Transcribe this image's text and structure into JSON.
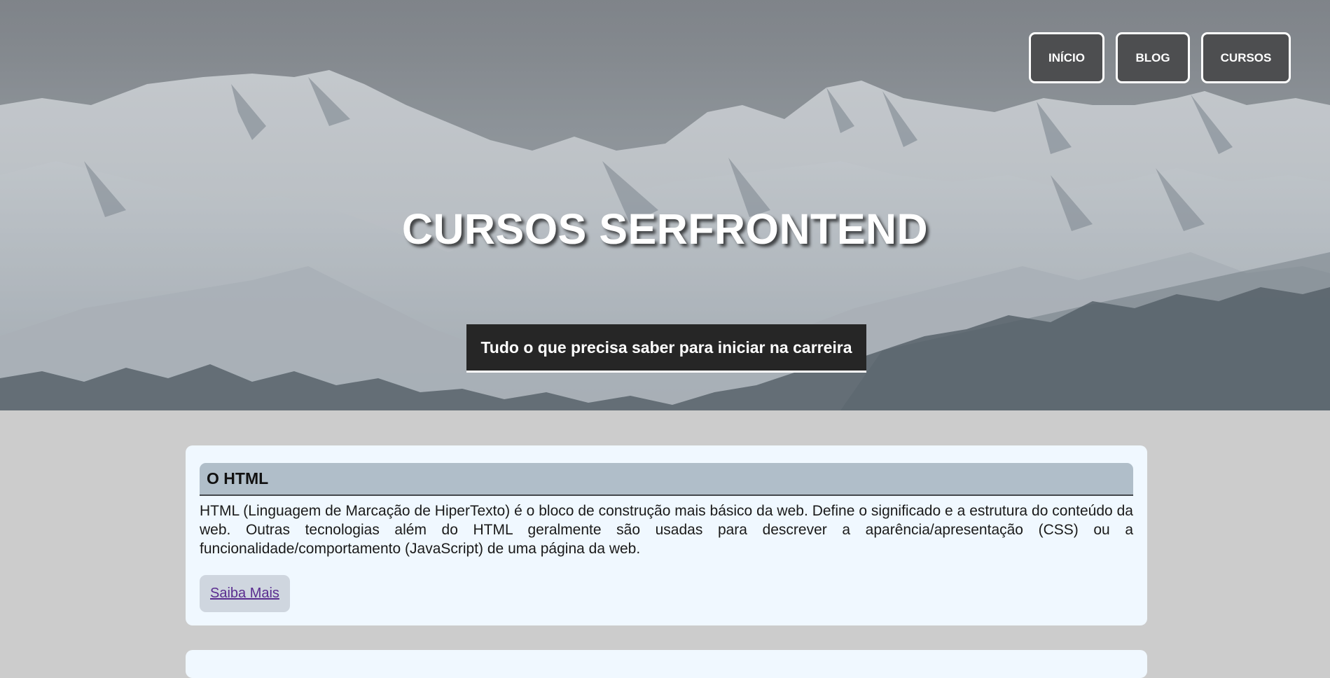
{
  "nav": {
    "items": [
      {
        "label": "INÍCIO"
      },
      {
        "label": "BLOG"
      },
      {
        "label": "CURSOS"
      }
    ]
  },
  "hero": {
    "title": "CURSOS SERFRONTEND",
    "subtitle": "Tudo o que precisa saber para iniciar na carreira"
  },
  "cards": [
    {
      "title": "O HTML",
      "text": "HTML (Linguagem de Marcação de HiperTexto) é o bloco de construção mais básico da web. Define o significado e a estrutura do conteúdo da web. Outras tecnologias além do HTML geralmente são usadas para descrever a aparência/apresentação (CSS) ou a funcionalidade/comportamento (JavaScript) de uma página da web.",
      "link_label": "Saiba Mais"
    }
  ],
  "colors": {
    "page_background": "#cccccc",
    "card_background": "#f0f8ff",
    "card_header": "#b0bec9",
    "nav_button": "#4d4e50",
    "subtitle_box": "#262626",
    "link": "#5a2c8f"
  }
}
